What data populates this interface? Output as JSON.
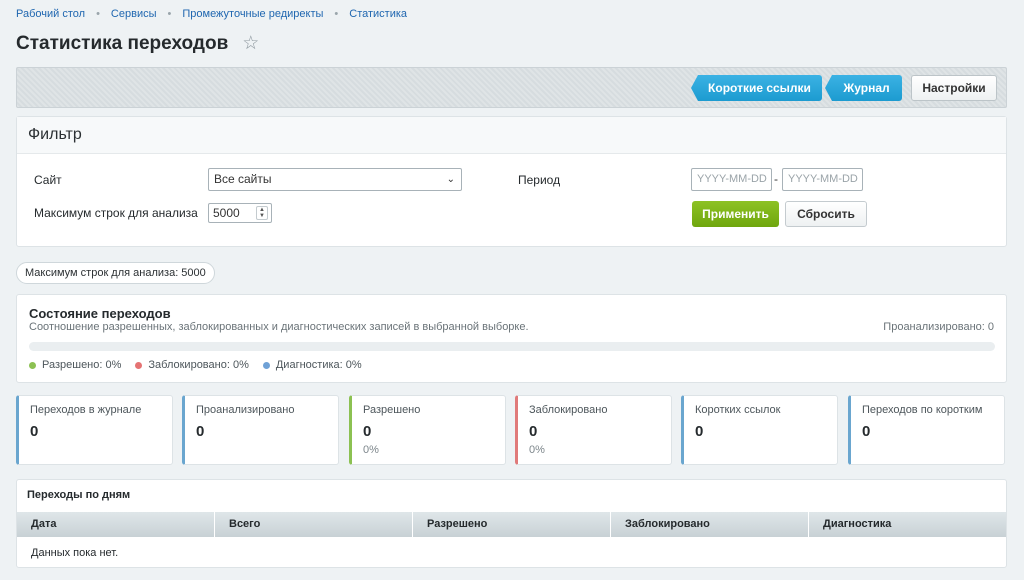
{
  "breadcrumb": [
    "Рабочий стол",
    "Сервисы",
    "Промежуточные редиректы",
    "Статистика"
  ],
  "page": {
    "title": "Статистика переходов"
  },
  "toolbar": {
    "short_links": "Короткие ссылки",
    "journal": "Журнал",
    "settings": "Настройки"
  },
  "filter": {
    "title": "Фильтр",
    "site_label": "Сайт",
    "site_value": "Все сайты",
    "max_rows_label": "Максимум строк для анализа",
    "max_rows_value": "5000",
    "period_label": "Период",
    "date_from_placeholder": "YYYY-MM-DD",
    "date_to_placeholder": "YYYY-MM-DD",
    "date_sep": "-",
    "apply": "Применить",
    "reset": "Сбросить"
  },
  "max_rows_pill": "Максимум строк для анализа: 5000",
  "state": {
    "title": "Состояние переходов",
    "subtitle": "Соотношение разрешенных, заблокированных и диагностических записей в выбранной выборке.",
    "analyzed": "Проанализировано: 0",
    "progress": {
      "allowed": 0,
      "blocked": 0,
      "diagnostics": 0
    },
    "legend": [
      {
        "label": "Разрешено: 0%",
        "color": "#8cc152"
      },
      {
        "label": "Заблокировано: 0%",
        "color": "#e57373"
      },
      {
        "label": "Диагностика: 0%",
        "color": "#6fa1d6"
      }
    ]
  },
  "cards": [
    {
      "label": "Переходов в журнале",
      "value": "0",
      "pct": "",
      "color": "#6aa6cf"
    },
    {
      "label": "Проанализировано",
      "value": "0",
      "pct": "",
      "color": "#6aa6cf"
    },
    {
      "label": "Разрешено",
      "value": "0",
      "pct": "0%",
      "color": "#8cc152"
    },
    {
      "label": "Заблокировано",
      "value": "0",
      "pct": "0%",
      "color": "#e07a7a"
    },
    {
      "label": "Коротких ссылок",
      "value": "0",
      "pct": "",
      "color": "#6aa6cf"
    },
    {
      "label": "Переходов по коротким",
      "value": "0",
      "pct": "",
      "color": "#6aa6cf"
    }
  ],
  "days": {
    "title": "Переходы по дням",
    "columns": [
      "Дата",
      "Всего",
      "Разрешено",
      "Заблокировано",
      "Диагностика"
    ],
    "empty": "Данных пока нет."
  }
}
